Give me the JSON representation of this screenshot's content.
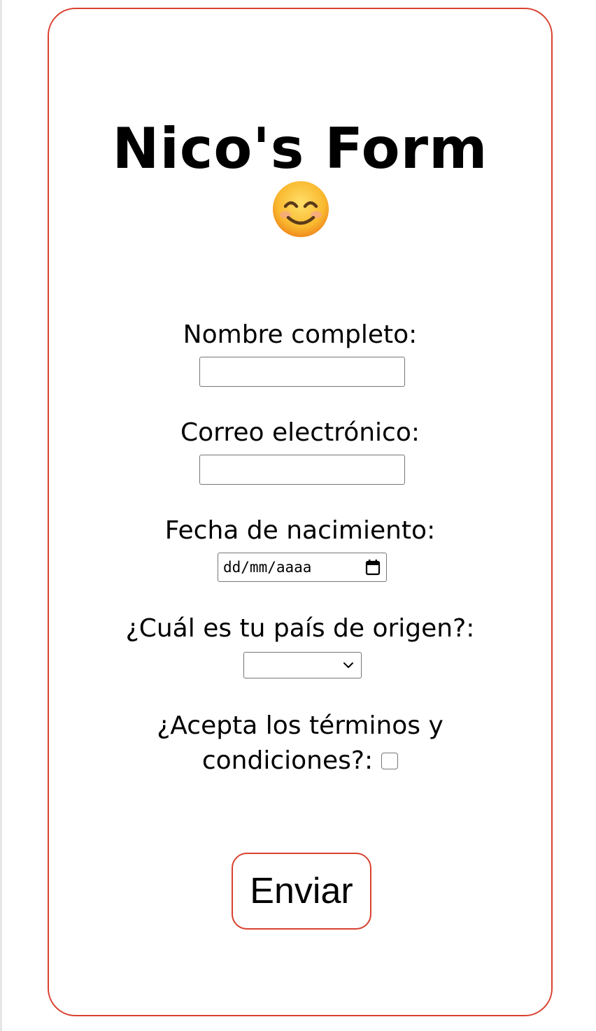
{
  "form": {
    "title": "Nico's Form",
    "emoji_icon": "smiling-face-icon",
    "fields": {
      "full_name": {
        "label": "Nombre completo:",
        "value": ""
      },
      "email": {
        "label": "Correo electrónico:",
        "value": ""
      },
      "birth_date": {
        "label": "Fecha de nacimiento:",
        "placeholder": "dd/mm/aaaa",
        "icon": "calendar-icon"
      },
      "country": {
        "label": "¿Cuál es tu país de origen?:",
        "selected": "",
        "icon": "chevron-down-icon"
      },
      "terms": {
        "label_line1": "¿Acepta los términos y",
        "label_line2": "condiciones?:",
        "checked": false
      }
    },
    "submit_label": "Enviar"
  },
  "colors": {
    "accent": "#d9412f",
    "input_border": "#767676",
    "background": "#ffffff"
  }
}
